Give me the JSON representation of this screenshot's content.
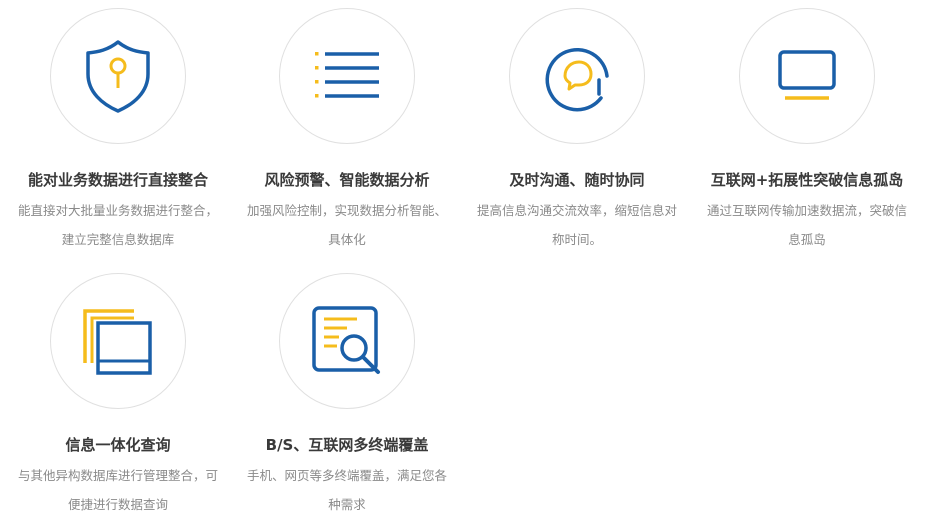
{
  "colors": {
    "blue": "#1a5fa8",
    "yellow": "#f5bc1c",
    "title": "#3a3a3a",
    "desc": "#8a8a8a",
    "ring": "#e0e0e0"
  },
  "features": [
    {
      "icon": "shield-key-icon",
      "title": "能对业务数据进行直接整合",
      "desc": "能直接对大批量业务数据进行整合，建立完整信息数据库"
    },
    {
      "icon": "list-icon",
      "title": "风险预警、智能数据分析",
      "desc": "加强风险控制，实现数据分析智能、具体化"
    },
    {
      "icon": "chat-bubble-icon",
      "title": "及时沟通、随时协同",
      "desc": "提高信息沟通交流效率，缩短信息对称时间。"
    },
    {
      "icon": "monitor-icon",
      "title": "互联网+拓展性突破信息孤岛",
      "desc": "通过互联网传输加速数据流，突破信息孤岛"
    },
    {
      "icon": "layered-windows-icon",
      "title": "信息一体化查询",
      "desc": "与其他异构数据库进行管理整合，可便捷进行数据查询"
    },
    {
      "icon": "document-search-icon",
      "title": "B/S、互联网多终端覆盖",
      "desc": "手机、网页等多终端覆盖，满足您各种需求"
    }
  ]
}
